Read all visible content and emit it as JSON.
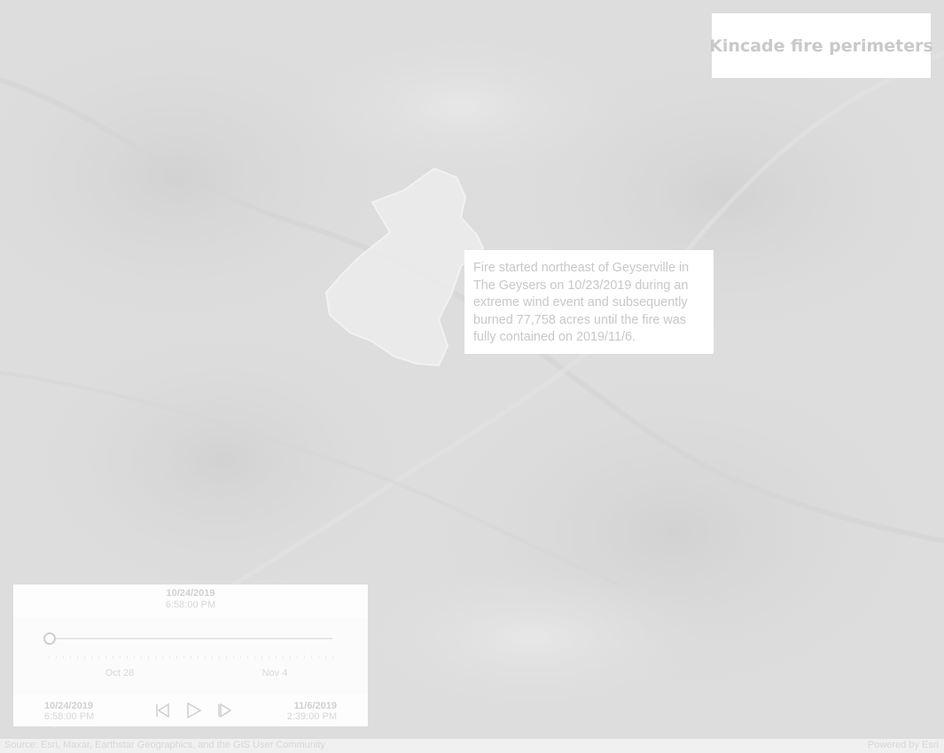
{
  "map": {
    "title": "Kincade fire perimeters",
    "annotation": "Fire started northeast of Geyserville in The Geysers on 10/23/2019 during an extreme wind event and subsequently burned 77,758 acres until the fire was fully contained on 2019/11/6."
  },
  "time_slider": {
    "current_date": "10/24/2019",
    "current_time": "6:58:00 PM",
    "tick_labels": [
      "Oct 28",
      "Nov 4"
    ],
    "start_date": "10/24/2019",
    "start_time": "6:58:00 PM",
    "end_date": "11/6/2019",
    "end_time": "2:39:00 PM",
    "position": 0
  },
  "attribution": {
    "source": "Source: Esri, Maxar, Earthstar Geographics, and the GIS User Community",
    "powered_by": "Powered by Esri"
  },
  "colors": {
    "basemap": "#dcdcdc",
    "panel": "#ffffff",
    "faded_text": "#c9c9c9"
  },
  "icons": {
    "previous": "step-back-icon",
    "play": "play-icon",
    "next": "step-forward-icon"
  }
}
